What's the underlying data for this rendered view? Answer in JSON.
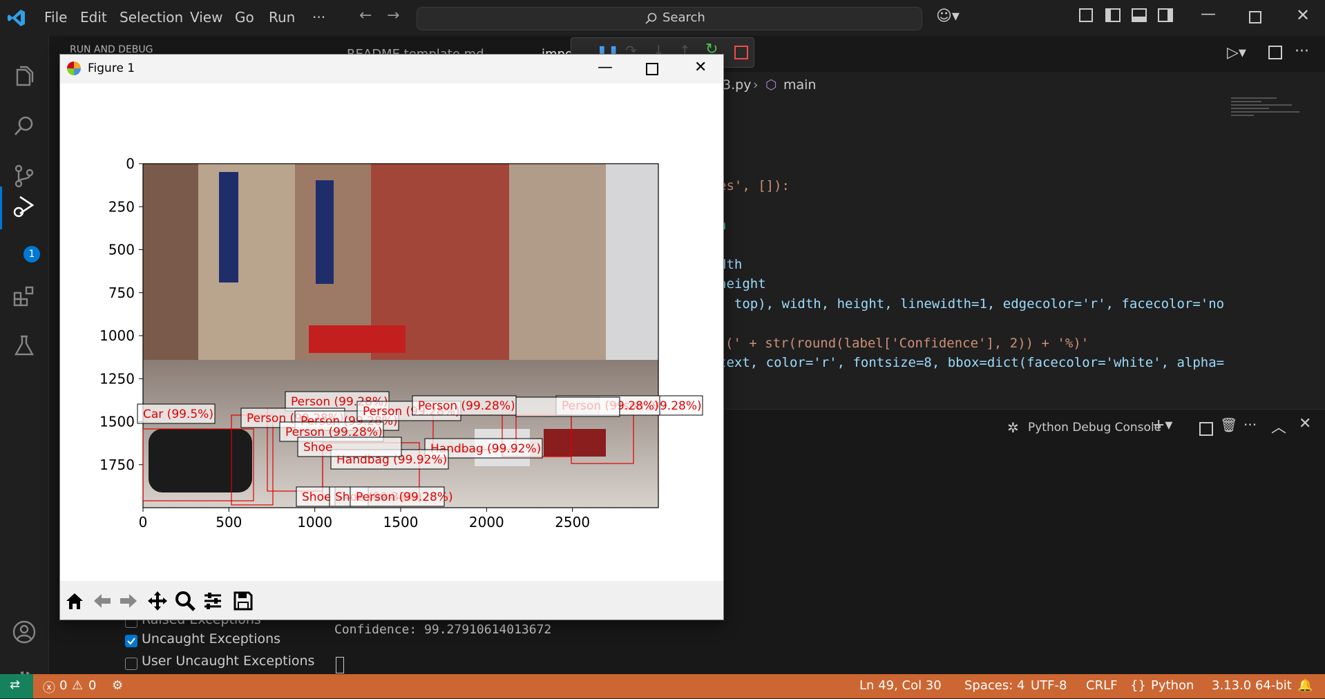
{
  "titlebar": {
    "menus": [
      "File",
      "Edit",
      "Selection",
      "View",
      "Go",
      "Run",
      "···"
    ],
    "search_label": "Search"
  },
  "activity": {
    "debug_badge": "1"
  },
  "sidepanel": {
    "header": "RUN AND DEBUG",
    "breakpoints": [
      {
        "label": "Raised Exceptions",
        "checked": false
      },
      {
        "label": "Uncaught Exceptions",
        "checked": true
      },
      {
        "label": "User Uncaught Exceptions",
        "checked": false
      }
    ]
  },
  "editor": {
    "tabs": [
      "README.template.md",
      "impo"
    ],
    "breadcrumb_file": "3.py",
    "breadcrumb_symbol": "main",
    "code_lines": [
      "es', []):",
      "n",
      "dth",
      "height",
      ", top), width, height, linewidth=1, edgecolor='r', facecolor='no",
      "(' + str(round(label['Confidence'], 2)) + '%)'",
      "text, color='r', fontsize=8, bbox=dict(facecolor='white', alpha="
    ]
  },
  "panel": {
    "title": "Python Debug Console",
    "output_line": "Confidence: 99.27910614013672"
  },
  "statusbar": {
    "errors": "0",
    "warnings": "0",
    "position": "Ln 49, Col 30",
    "spaces": "Spaces: 4",
    "encoding": "UTF-8",
    "eol": "CRLF",
    "language": "Python",
    "version": "3.13.0 64-bit"
  },
  "figure": {
    "title": "Figure 1",
    "x_ticks": [
      "0",
      "500",
      "1000",
      "1500",
      "2000",
      "2500"
    ],
    "y_ticks": [
      "0",
      "250",
      "500",
      "750",
      "1000",
      "1250",
      "1500",
      "1750"
    ],
    "labels": [
      "Person (99.28%)",
      "Car (99.5%)",
      "Person (99.28%)",
      "Person (99.28%)",
      "Person (99.28%)",
      "Person (99.28%)",
      "Person (99.28%)",
      "Person (99.28%)",
      "Person (99.28%)",
      "Handbag (99.92%)",
      "Handbag (99.92%)",
      "Shoe",
      "Shoe",
      "Shoe (99.33%)",
      "Person (99.28%)"
    ]
  },
  "colors": {
    "accent": "#0078d4",
    "status": "#cc6633",
    "detection": "#e00000"
  }
}
